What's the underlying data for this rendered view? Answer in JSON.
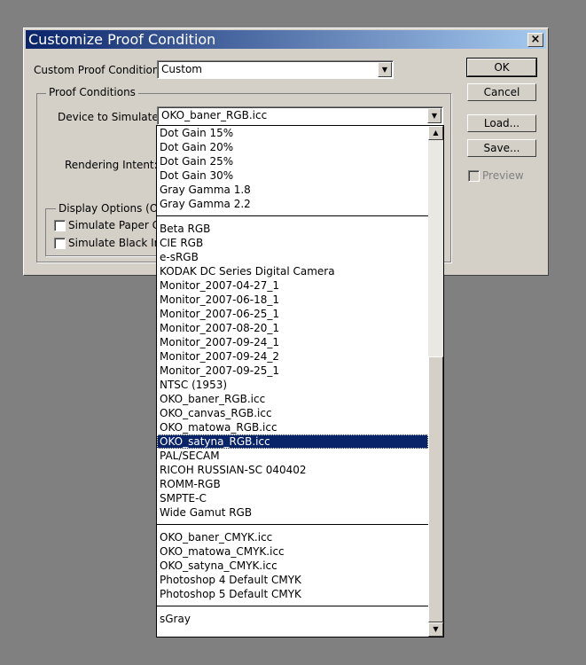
{
  "dialog": {
    "title": "Customize Proof Condition",
    "close_glyph": "×",
    "custom_proof_label": "Custom Proof Condition:",
    "custom_proof_value": "Custom",
    "proof_conditions_group": "Proof Conditions",
    "device_label": "Device to Simulate:",
    "device_value": "OKO_baner_RGB.icc",
    "rendering_label": "Rendering Intent:",
    "display_options_group": "Display Options (On-",
    "simulate_paper_label": "Simulate Paper Co",
    "simulate_black_label": "Simulate Black Ink",
    "ok_label": "OK",
    "cancel_label": "Cancel",
    "load_label": "Load...",
    "save_label": "Save...",
    "preview_label": "Preview"
  },
  "dropdown": {
    "group1": [
      "Dot Gain 15%",
      "Dot Gain 20%",
      "Dot Gain 25%",
      "Dot Gain 30%",
      "Gray Gamma 1.8",
      "Gray Gamma 2.2"
    ],
    "group2": [
      "Beta RGB",
      "CIE RGB",
      "e-sRGB",
      "KODAK DC Series Digital Camera",
      "Monitor_2007-04-27_1",
      "Monitor_2007-06-18_1",
      "Monitor_2007-06-25_1",
      "Monitor_2007-08-20_1",
      "Monitor_2007-09-24_1",
      "Monitor_2007-09-24_2",
      "Monitor_2007-09-25_1",
      "NTSC (1953)",
      "OKO_baner_RGB.icc",
      "OKO_canvas_RGB.icc",
      "OKO_matowa_RGB.icc",
      "OKO_satyna_RGB.icc",
      "PAL/SECAM",
      "RICOH RUSSIAN-SC 040402",
      "ROMM-RGB",
      "SMPTE-C",
      "Wide Gamut RGB"
    ],
    "group3": [
      "OKO_baner_CMYK.icc",
      "OKO_matowa_CMYK.icc",
      "OKO_satyna_CMYK.icc",
      "Photoshop 4 Default CMYK",
      "Photoshop 5 Default CMYK"
    ],
    "group4": [
      "sGray"
    ],
    "selected": "OKO_satyna_RGB.icc"
  },
  "colors": {
    "titlebar": "#0a246a",
    "selection": "#0a246a",
    "face": "#d4d0c8"
  }
}
